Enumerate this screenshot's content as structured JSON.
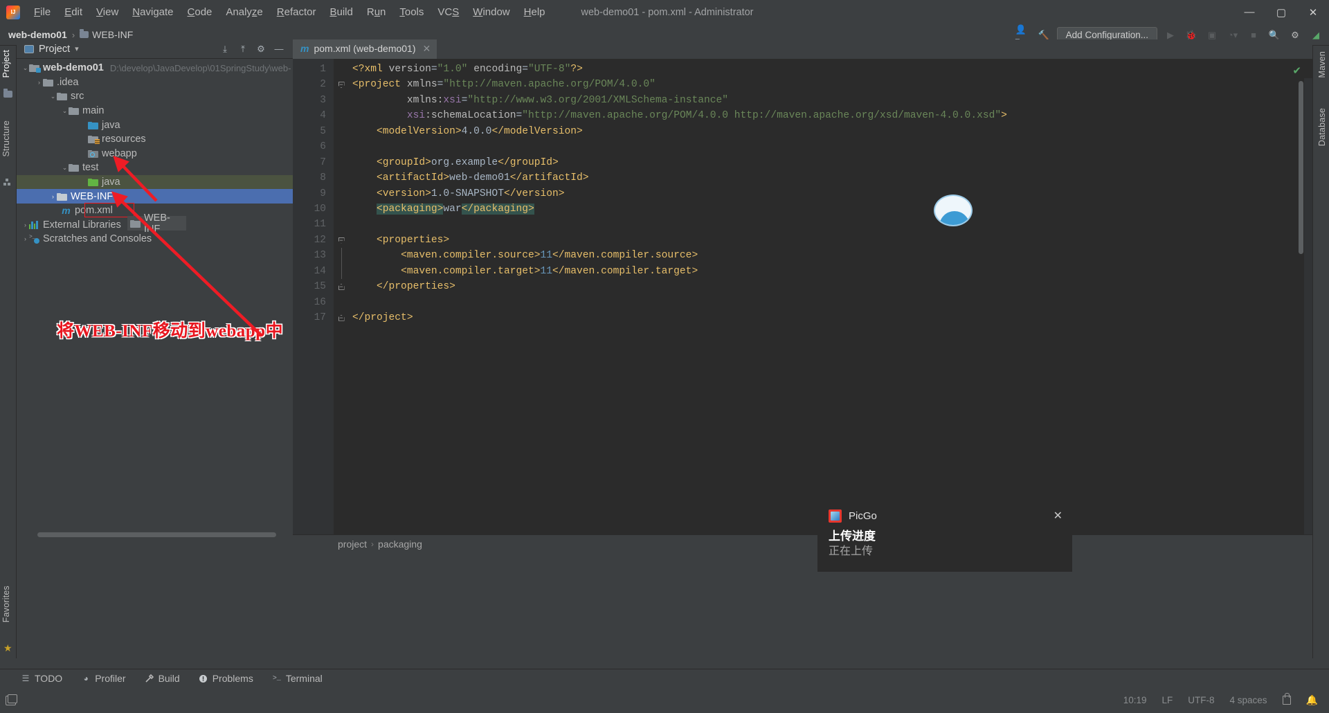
{
  "window": {
    "title": "web-demo01 - pom.xml - Administrator",
    "minimize": "—",
    "maximize": "▢",
    "close": "✕"
  },
  "menu": [
    {
      "label": "File"
    },
    {
      "label": "Edit"
    },
    {
      "label": "View"
    },
    {
      "label": "Navigate"
    },
    {
      "label": "Code"
    },
    {
      "label": "Analyze"
    },
    {
      "label": "Refactor"
    },
    {
      "label": "Build"
    },
    {
      "label": "Run"
    },
    {
      "label": "Tools"
    },
    {
      "label": "VCS"
    },
    {
      "label": "Window"
    },
    {
      "label": "Help"
    }
  ],
  "navbar": {
    "crumb_project": "web-demo01",
    "crumb_sep": "›",
    "crumb_file": "WEB-INF",
    "add_configuration": "Add Configuration..."
  },
  "left_strip": {
    "project_tab": "Project",
    "structure_tab": "Structure",
    "favorites_tab": "Favorites"
  },
  "right_strip": {
    "maven_tab": "Maven",
    "database_tab": "Database"
  },
  "project_panel": {
    "title": "Project",
    "dropdown_caret": "▾",
    "tree": [
      {
        "label": "web-demo01",
        "path": "D:\\develop\\JavaDevelop\\01SpringStudy\\web-",
        "depth": 0,
        "arrow": "⌄",
        "icon": "module-folder-icon",
        "bold": true
      },
      {
        "label": ".idea",
        "depth": 1,
        "arrow": "›",
        "icon": "folder-icon"
      },
      {
        "label": "src",
        "depth": 1,
        "arrow": "⌄",
        "icon": "folder-icon"
      },
      {
        "label": "main",
        "depth": 2,
        "arrow": "⌄",
        "icon": "folder-icon"
      },
      {
        "label": "java",
        "depth": 3,
        "arrow": "",
        "icon": "source-folder-icon"
      },
      {
        "label": "resources",
        "depth": 3,
        "arrow": "",
        "icon": "resources-folder-icon"
      },
      {
        "label": "webapp",
        "depth": 3,
        "arrow": "",
        "icon": "webapp-folder-icon"
      },
      {
        "label": "test",
        "depth": 2,
        "arrow": "⌄",
        "icon": "folder-icon"
      },
      {
        "label": "java",
        "depth": 3,
        "arrow": "",
        "icon": "test-source-folder-icon"
      },
      {
        "label": "WEB-INF",
        "depth": 1,
        "arrow": "›",
        "icon": "folder-icon"
      },
      {
        "label": "pom.xml",
        "depth": 2,
        "arrow": "",
        "icon": "maven-file-icon"
      },
      {
        "label": "External Libraries",
        "depth": 0,
        "arrow": "›",
        "icon": "libraries-icon"
      },
      {
        "label": "Scratches and Consoles",
        "depth": 0,
        "arrow": "›",
        "icon": "scratches-icon"
      }
    ],
    "drag_ghost_label": "WEB-INF",
    "annotation": "将WEB-INF移动到webapp中"
  },
  "editor": {
    "tab_label": "pom.xml (web-demo01)",
    "tab_close": "✕",
    "inspection_ok": "✔",
    "lines": [
      {
        "n": "1"
      },
      {
        "n": "2"
      },
      {
        "n": "3"
      },
      {
        "n": "4"
      },
      {
        "n": "5"
      },
      {
        "n": "6"
      },
      {
        "n": "7"
      },
      {
        "n": "8"
      },
      {
        "n": "9"
      },
      {
        "n": "10"
      },
      {
        "n": "11"
      },
      {
        "n": "12"
      },
      {
        "n": "13"
      },
      {
        "n": "14"
      },
      {
        "n": "15"
      },
      {
        "n": "16"
      },
      {
        "n": "17"
      }
    ],
    "code_text": [
      "<?xml version=\"1.0\" encoding=\"UTF-8\"?>",
      "<project xmlns=\"http://maven.apache.org/POM/4.0.0\"",
      "         xmlns:xsi=\"http://www.w3.org/2001/XMLSchema-instance\"",
      "         xsi:schemaLocation=\"http://maven.apache.org/POM/4.0.0 http://maven.apache.org/xsd/maven-4.0.0.xsd\">",
      "    <modelVersion>4.0.0</modelVersion>",
      "",
      "    <groupId>org.example</groupId>",
      "    <artifactId>web-demo01</artifactId>",
      "    <version>1.0-SNAPSHOT</version>",
      "    <packaging>war</packaging>",
      "",
      "    <properties>",
      "        <maven.compiler.source>11</maven.compiler.source>",
      "        <maven.compiler.target>11</maven.compiler.target>",
      "    </properties>",
      "",
      "</project>"
    ]
  },
  "breadcrumb_bar": {
    "first": "project",
    "sep": "›",
    "second": "packaging"
  },
  "bottom_tools": [
    {
      "label": "TODO",
      "icon": "todo-icon",
      "glyph": "☰"
    },
    {
      "label": "Profiler",
      "icon": "profiler-icon",
      "glyph": "◕"
    },
    {
      "label": "Build",
      "icon": "build-icon",
      "glyph": "🔨"
    },
    {
      "label": "Problems",
      "icon": "problems-icon",
      "glyph": "!"
    },
    {
      "label": "Terminal",
      "icon": "terminal-icon",
      "glyph": ">_"
    }
  ],
  "statusbar": {
    "caret_position": "10:19",
    "line_separator": "LF",
    "encoding": "UTF-8",
    "indent": "4 spaces",
    "lock_icon": "lock-icon"
  },
  "picgo": {
    "app_name": "PicGo",
    "close": "✕",
    "title": "上传进度",
    "subtitle": "正在上传"
  },
  "colors": {
    "selection_blue": "#4b6eaf",
    "test_source_green": "#4b5340",
    "annotation_red": "#e8161f",
    "tag_yellow": "#e8bf6a",
    "string_green": "#6a8759"
  }
}
